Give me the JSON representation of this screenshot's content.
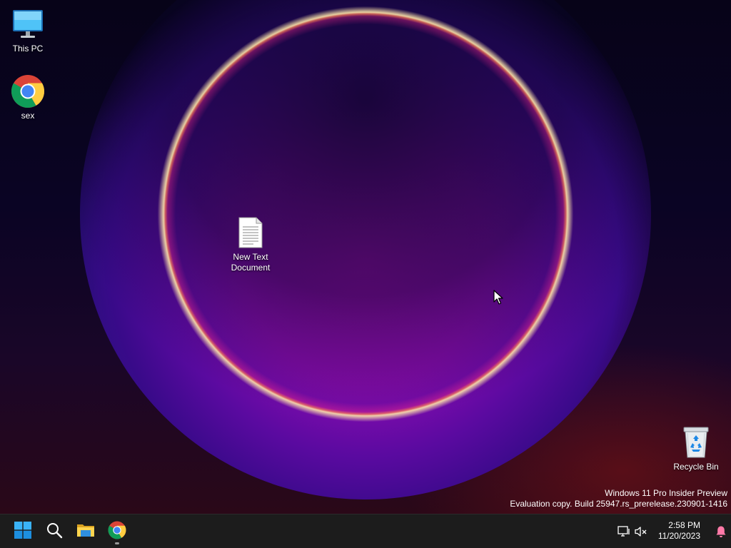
{
  "desktop": {
    "icons": [
      {
        "label": "This PC",
        "icon": "monitor-icon"
      },
      {
        "label": "sex",
        "icon": "chrome-icon"
      },
      {
        "label": "New Text Document",
        "icon": "text-document-icon"
      },
      {
        "label": "Recycle Bin",
        "icon": "recycle-bin-icon"
      }
    ],
    "watermark": {
      "line1": "Windows 11 Pro Insider Preview",
      "line2": "Evaluation copy. Build 25947.rs_prerelease.230901-1416"
    }
  },
  "taskbar": {
    "buttons": [
      {
        "name": "start",
        "icon": "windows-logo-icon"
      },
      {
        "name": "search",
        "icon": "search-icon"
      },
      {
        "name": "file-explorer",
        "icon": "folder-icon"
      },
      {
        "name": "chrome",
        "icon": "chrome-icon"
      }
    ],
    "tray": {
      "network_icon": "network-icon",
      "volume_icon": "volume-muted-icon",
      "notification_icon": "bell-icon"
    },
    "clock": {
      "time": "2:58 PM",
      "date": "11/20/2023"
    }
  },
  "colors": {
    "taskbar_bg": "#1c1c1c",
    "accent_start": "#0a84ff",
    "notification_bell": "#ff7aa8"
  }
}
